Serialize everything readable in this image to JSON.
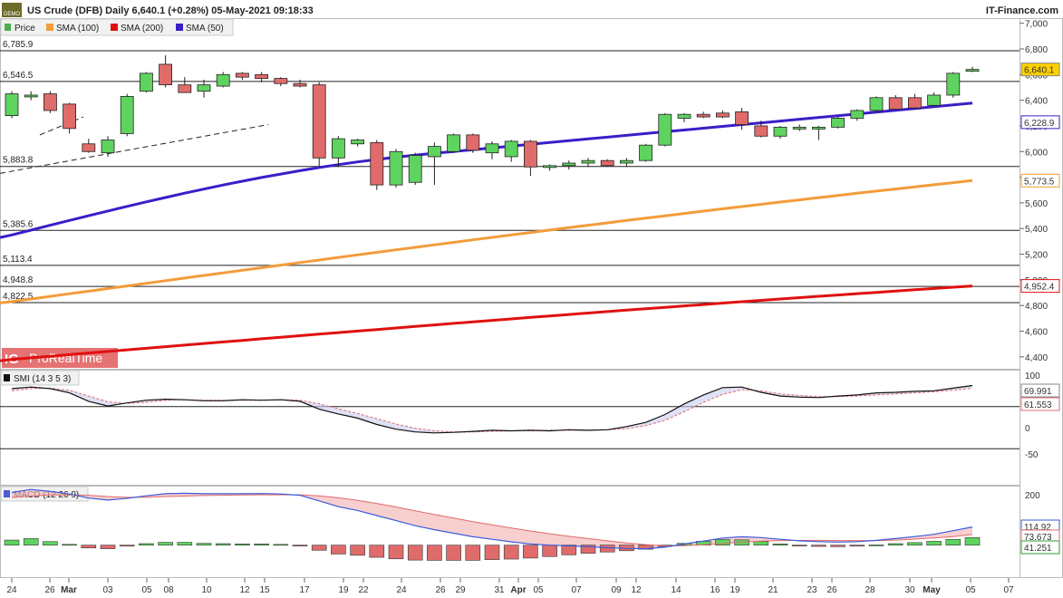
{
  "header": {
    "demo_badge": "DEMO",
    "title": "US Crude (DFB) Daily 6,640.1 (+0.28%) 05-May-2021 09:18:33",
    "brand": "IT-Finance.com"
  },
  "legend": {
    "items": [
      {
        "label": "Price",
        "color": "#4caf50"
      },
      {
        "label": "SMA (100)",
        "color": "#f39c3a"
      },
      {
        "label": "SMA (200)",
        "color": "#e01010"
      },
      {
        "label": "SMA (50)",
        "color": "#3a1ec8"
      }
    ]
  },
  "watermark": {
    "logo": "IG",
    "text": "ProRealTime"
  },
  "colors": {
    "up": "#5fd35f",
    "down": "#e06b6b",
    "sma50": "#3a1ec8",
    "sma100": "#f39c3a",
    "sma200": "#e01010"
  },
  "chart_data": [
    {
      "type": "candlestick",
      "title": "US Crude (DFB) Daily",
      "x_ticks": [
        "24",
        "26",
        "Mar",
        "03",
        "05",
        "08",
        "10",
        "12",
        "15",
        "17",
        "19",
        "22",
        "24",
        "26",
        "29",
        "31",
        "Apr",
        "05",
        "07",
        "09",
        "12",
        "14",
        "16",
        "19",
        "21",
        "23",
        "26",
        "28",
        "30",
        "May",
        "05",
        "07"
      ],
      "y_ticks": [
        "7,000",
        "6,800",
        "6,600",
        "6,400",
        "6,200",
        "6,000",
        "5,800",
        "5,600",
        "5,400",
        "5,200",
        "5,000",
        "4,800",
        "4,600",
        "4,400"
      ],
      "ylim": [
        4300,
        7040
      ],
      "horizontal_levels": [
        "6,785.9",
        "6,546.5",
        "5,883.8",
        "5,385.6",
        "5,113.4",
        "4,948.8",
        "4,822.5"
      ],
      "last_values": {
        "price": "6,640.1",
        "sma50": "6,228.9",
        "sma100": "5,773.5",
        "sma200": "4,952.4"
      },
      "candles": [
        {
          "o": 6280,
          "h": 6470,
          "l": 6260,
          "c": 6450
        },
        {
          "o": 6440,
          "h": 6470,
          "l": 6400,
          "c": 6440
        },
        {
          "o": 6450,
          "h": 6470,
          "l": 6300,
          "c": 6320
        },
        {
          "o": 6370,
          "h": 6380,
          "l": 6140,
          "c": 6180
        },
        {
          "o": 6060,
          "h": 6100,
          "l": 5990,
          "c": 6000
        },
        {
          "o": 5990,
          "h": 6120,
          "l": 5960,
          "c": 6090
        },
        {
          "o": 6140,
          "h": 6450,
          "l": 6120,
          "c": 6430
        },
        {
          "o": 6470,
          "h": 6620,
          "l": 6460,
          "c": 6610
        },
        {
          "o": 6680,
          "h": 6750,
          "l": 6500,
          "c": 6520
        },
        {
          "o": 6520,
          "h": 6580,
          "l": 6460,
          "c": 6460
        },
        {
          "o": 6470,
          "h": 6560,
          "l": 6420,
          "c": 6520
        },
        {
          "o": 6510,
          "h": 6620,
          "l": 6500,
          "c": 6600
        },
        {
          "o": 6610,
          "h": 6620,
          "l": 6560,
          "c": 6580
        },
        {
          "o": 6600,
          "h": 6620,
          "l": 6540,
          "c": 6570
        },
        {
          "o": 6570,
          "h": 6580,
          "l": 6510,
          "c": 6530
        },
        {
          "o": 6530,
          "h": 6560,
          "l": 6500,
          "c": 6510
        },
        {
          "o": 6520,
          "h": 6540,
          "l": 5880,
          "c": 5950
        },
        {
          "o": 5950,
          "h": 6120,
          "l": 5880,
          "c": 6100
        },
        {
          "o": 6060,
          "h": 6100,
          "l": 6040,
          "c": 6090
        },
        {
          "o": 6070,
          "h": 6090,
          "l": 5700,
          "c": 5740
        },
        {
          "o": 5740,
          "h": 6020,
          "l": 5720,
          "c": 6000
        },
        {
          "o": 5760,
          "h": 5990,
          "l": 5740,
          "c": 5970
        },
        {
          "o": 5960,
          "h": 6070,
          "l": 5740,
          "c": 6040
        },
        {
          "o": 6000,
          "h": 6140,
          "l": 5990,
          "c": 6130
        },
        {
          "o": 6130,
          "h": 6140,
          "l": 5990,
          "c": 6010
        },
        {
          "o": 5990,
          "h": 6080,
          "l": 5940,
          "c": 6060
        },
        {
          "o": 5960,
          "h": 6090,
          "l": 5920,
          "c": 6080
        },
        {
          "o": 6080,
          "h": 6090,
          "l": 5810,
          "c": 5880
        },
        {
          "o": 5880,
          "h": 5900,
          "l": 5850,
          "c": 5890
        },
        {
          "o": 5890,
          "h": 5930,
          "l": 5860,
          "c": 5910
        },
        {
          "o": 5910,
          "h": 5950,
          "l": 5880,
          "c": 5930
        },
        {
          "o": 5930,
          "h": 5940,
          "l": 5880,
          "c": 5890
        },
        {
          "o": 5910,
          "h": 5950,
          "l": 5880,
          "c": 5930
        },
        {
          "o": 5930,
          "h": 6060,
          "l": 5920,
          "c": 6050
        },
        {
          "o": 6050,
          "h": 6300,
          "l": 6040,
          "c": 6290
        },
        {
          "o": 6260,
          "h": 6300,
          "l": 6230,
          "c": 6290
        },
        {
          "o": 6290,
          "h": 6310,
          "l": 6260,
          "c": 6270
        },
        {
          "o": 6300,
          "h": 6320,
          "l": 6260,
          "c": 6270
        },
        {
          "o": 6310,
          "h": 6340,
          "l": 6170,
          "c": 6210
        },
        {
          "o": 6200,
          "h": 6240,
          "l": 6110,
          "c": 6120
        },
        {
          "o": 6120,
          "h": 6200,
          "l": 6100,
          "c": 6190
        },
        {
          "o": 6180,
          "h": 6210,
          "l": 6160,
          "c": 6190
        },
        {
          "o": 6180,
          "h": 6200,
          "l": 6090,
          "c": 6190
        },
        {
          "o": 6190,
          "h": 6270,
          "l": 6180,
          "c": 6260
        },
        {
          "o": 6260,
          "h": 6330,
          "l": 6240,
          "c": 6320
        },
        {
          "o": 6320,
          "h": 6430,
          "l": 6310,
          "c": 6420
        },
        {
          "o": 6420,
          "h": 6440,
          "l": 6320,
          "c": 6330
        },
        {
          "o": 6420,
          "h": 6450,
          "l": 6330,
          "c": 6340
        },
        {
          "o": 6360,
          "h": 6460,
          "l": 6350,
          "c": 6440
        },
        {
          "o": 6440,
          "h": 6620,
          "l": 6420,
          "c": 6610
        },
        {
          "o": 6630,
          "h": 6660,
          "l": 6620,
          "c": 6640
        }
      ]
    },
    {
      "type": "line",
      "title": "SMI (14 3 5 3)",
      "y_ticks": [
        "100",
        "50",
        "0",
        "-50"
      ],
      "ylim": [
        -110,
        110
      ],
      "last_values": [
        "69.991",
        "61.553"
      ],
      "series": [
        {
          "values": [
            74,
            77,
            74,
            66,
            50,
            41,
            47,
            52,
            54,
            53,
            51,
            51,
            53,
            52,
            53,
            50,
            35,
            26,
            18,
            6,
            -3,
            -8,
            -10,
            -9,
            -7,
            -5,
            -6,
            -5,
            -6,
            -4,
            -5,
            -4,
            2,
            10,
            25,
            45,
            62,
            76,
            77,
            67,
            60,
            58,
            57,
            60,
            62,
            66,
            67,
            69,
            70,
            75,
            80
          ]
        },
        {
          "values": [
            70,
            74,
            75,
            71,
            60,
            49,
            46,
            48,
            52,
            53,
            52,
            52,
            52,
            52,
            53,
            52,
            45,
            36,
            27,
            17,
            7,
            -1,
            -6,
            -8,
            -8,
            -7,
            -6,
            -6,
            -5,
            -5,
            -5,
            -4,
            -2,
            4,
            14,
            30,
            48,
            63,
            72,
            70,
            64,
            61,
            59,
            59,
            60,
            62,
            64,
            66,
            68,
            71,
            75
          ]
        }
      ]
    },
    {
      "type": "bar",
      "title": "MACD (12 26 9)",
      "y_ticks": [
        "200"
      ],
      "ylim": [
        -130,
        235
      ],
      "last_values": [
        "114.92",
        "73.673",
        "41.251"
      ],
      "series": [
        {
          "values": [
            208,
            220,
            212,
            202,
            186,
            178,
            185,
            195,
            203,
            205,
            203,
            203,
            203,
            204,
            202,
            197,
            175,
            152,
            137,
            117,
            97,
            77,
            61,
            47,
            33,
            23,
            13,
            5,
            0,
            -3,
            -6,
            -10,
            -13,
            -14,
            -8,
            5,
            16,
            28,
            33,
            30,
            23,
            17,
            14,
            12,
            14,
            19,
            26,
            34,
            43,
            57,
            72
          ]
        },
        {
          "values": [
            188,
            194,
            198,
            199,
            197,
            192,
            189,
            189,
            192,
            194,
            196,
            197,
            198,
            199,
            199,
            199,
            195,
            187,
            177,
            165,
            151,
            136,
            121,
            107,
            93,
            80,
            68,
            56,
            45,
            35,
            26,
            17,
            9,
            2,
            -3,
            -2,
            1,
            6,
            12,
            16,
            18,
            19,
            19,
            18,
            18,
            18,
            20,
            24,
            28,
            34,
            42
          ]
        },
        {
          "values": [
            20,
            26,
            14,
            3,
            -11,
            -14,
            -4,
            6,
            11,
            11,
            7,
            6,
            5,
            5,
            3,
            -2,
            -20,
            -35,
            -40,
            -48,
            -54,
            -59,
            -60,
            -60,
            -60,
            -57,
            -55,
            -51,
            -45,
            -38,
            -32,
            -27,
            -22,
            -16,
            -5,
            7,
            15,
            22,
            21,
            14,
            5,
            -2,
            -5,
            -6,
            -4,
            1,
            6,
            10,
            15,
            23,
            30
          ]
        }
      ]
    }
  ]
}
